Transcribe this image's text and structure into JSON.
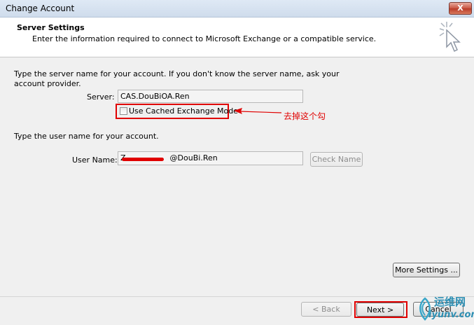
{
  "window": {
    "title": "Change Account",
    "close_label": "X"
  },
  "header": {
    "title": "Server Settings",
    "subtitle": "Enter the information required to connect to Microsoft Exchange or a compatible service."
  },
  "server_section": {
    "instructions": "Type the server name for your account. If you don't know the server name, ask your",
    "instructions_line2": "account provider.",
    "server_label": "Server:",
    "server_value": "CAS.DouBiOA.Ren",
    "cached_mode_label": "Use Cached Exchange Mode",
    "cached_mode_checked": false
  },
  "annotation": {
    "text": "去掉这个勾",
    "color": "#e00000"
  },
  "user_section": {
    "instructions": "Type the user name for your account.",
    "username_label": "User Name:",
    "username_visible_start": "Z",
    "username_visible_domain": "@DouBi.Ren",
    "check_name_label": "Check Name"
  },
  "buttons": {
    "more_settings": "More Settings ...",
    "back": "< Back",
    "next": "Next >",
    "cancel": "Cancel"
  },
  "watermark": {
    "line1": "运维网",
    "line2": "iyunv.com"
  }
}
